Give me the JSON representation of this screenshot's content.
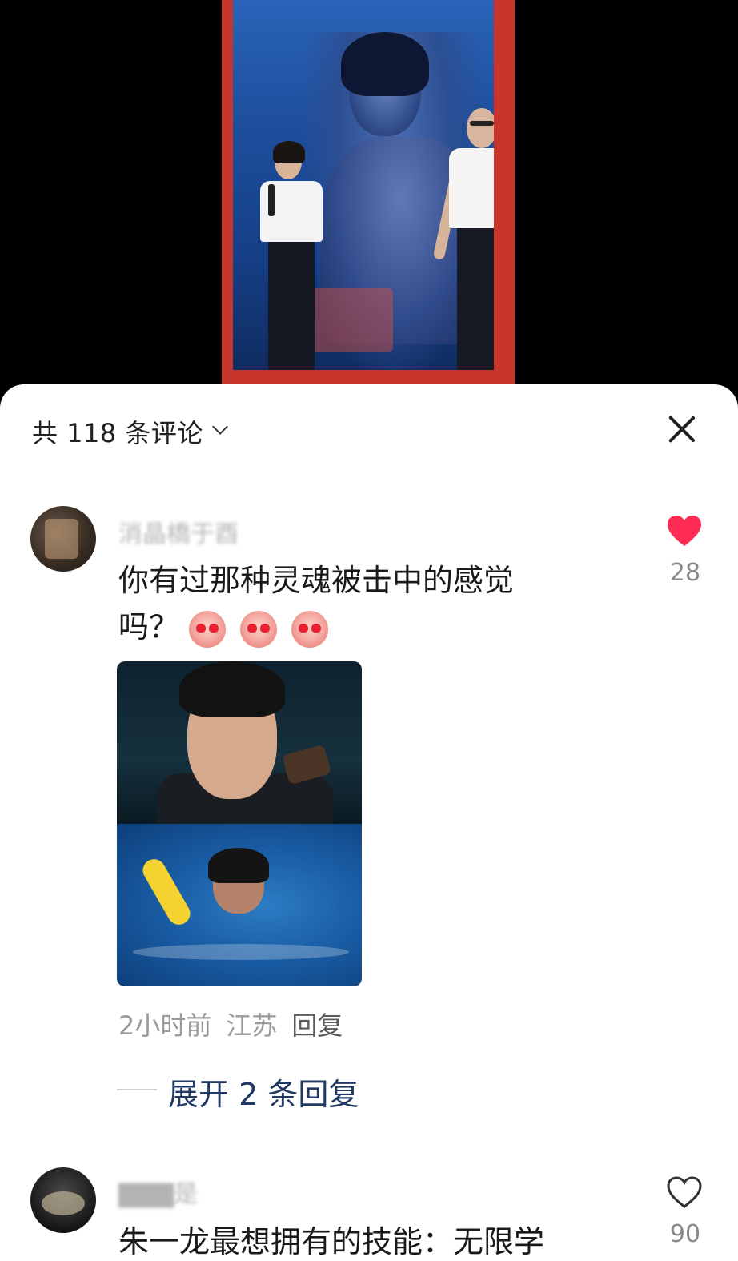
{
  "header": {
    "comment_count_label": "共 118 条评论"
  },
  "comments": [
    {
      "username": "消晶橋于酉",
      "text_line1": "你有过那种灵魂被击中的感觉",
      "text_line2": "吗？",
      "emojis": [
        "heart-eyes-peach-emoji",
        "heart-eyes-peach-emoji",
        "heart-eyes-peach-emoji"
      ],
      "likes": "28",
      "liked": true,
      "time": "2小时前",
      "location": "江苏",
      "reply_label": "回复",
      "expand_replies": "展开 2 条回复"
    },
    {
      "username": "▇▇▇是",
      "text_line1": "朱一龙最想拥有的技能：无限学",
      "likes": "90",
      "liked": false
    }
  ],
  "colors": {
    "like_active": "#fe2c55",
    "expand_text": "#223a63",
    "meta_text": "#9a9a9a"
  }
}
